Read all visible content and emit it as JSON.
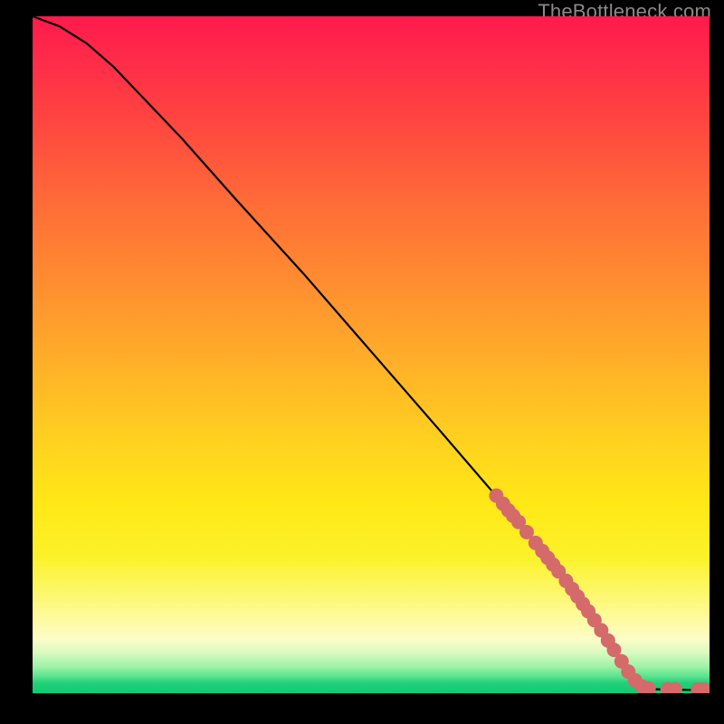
{
  "watermark": "TheBottleneck.com",
  "colors": {
    "point_fill": "#d46a6a",
    "curve_stroke": "#000000"
  },
  "chart_data": {
    "type": "line",
    "title": "",
    "xlabel": "",
    "ylabel": "",
    "xlim": [
      0,
      100
    ],
    "ylim": [
      0,
      100
    ],
    "grid": false,
    "note": "Axes are unlabeled in source; x/y normalized 0-100. Curve falls from top-left to a flat floor near y=0 past x≈88.",
    "curve": [
      {
        "x": 0,
        "y": 100
      },
      {
        "x": 4,
        "y": 98.5
      },
      {
        "x": 8,
        "y": 96
      },
      {
        "x": 12,
        "y": 92.5
      },
      {
        "x": 16,
        "y": 88.3
      },
      {
        "x": 22,
        "y": 82
      },
      {
        "x": 30,
        "y": 73
      },
      {
        "x": 40,
        "y": 62
      },
      {
        "x": 50,
        "y": 50.5
      },
      {
        "x": 60,
        "y": 39
      },
      {
        "x": 68,
        "y": 29.7
      },
      {
        "x": 72,
        "y": 25
      },
      {
        "x": 76,
        "y": 20.2
      },
      {
        "x": 80,
        "y": 15
      },
      {
        "x": 84,
        "y": 9.3
      },
      {
        "x": 86,
        "y": 6.3
      },
      {
        "x": 88,
        "y": 3.2
      },
      {
        "x": 89.5,
        "y": 1.2
      },
      {
        "x": 91,
        "y": 0.6
      },
      {
        "x": 94,
        "y": 0.55
      },
      {
        "x": 97,
        "y": 0.5
      },
      {
        "x": 100,
        "y": 0.5
      }
    ],
    "points": [
      {
        "x": 68.5,
        "y": 29.2
      },
      {
        "x": 69.5,
        "y": 28.0
      },
      {
        "x": 70.3,
        "y": 27.0
      },
      {
        "x": 71.0,
        "y": 26.2
      },
      {
        "x": 71.8,
        "y": 25.3
      },
      {
        "x": 73.0,
        "y": 23.8
      },
      {
        "x": 74.3,
        "y": 22.2
      },
      {
        "x": 75.3,
        "y": 21.0
      },
      {
        "x": 76.1,
        "y": 20.0
      },
      {
        "x": 76.9,
        "y": 19.0
      },
      {
        "x": 77.7,
        "y": 18.0
      },
      {
        "x": 78.8,
        "y": 16.6
      },
      {
        "x": 79.7,
        "y": 15.4
      },
      {
        "x": 80.5,
        "y": 14.3
      },
      {
        "x": 81.3,
        "y": 13.2
      },
      {
        "x": 82.1,
        "y": 12.1
      },
      {
        "x": 83.0,
        "y": 10.8
      },
      {
        "x": 84.0,
        "y": 9.3
      },
      {
        "x": 85.0,
        "y": 7.8
      },
      {
        "x": 85.9,
        "y": 6.4
      },
      {
        "x": 87.0,
        "y": 4.7
      },
      {
        "x": 88.0,
        "y": 3.2
      },
      {
        "x": 89.0,
        "y": 1.9
      },
      {
        "x": 90.0,
        "y": 1.0
      },
      {
        "x": 91.0,
        "y": 0.7
      },
      {
        "x": 93.8,
        "y": 0.6
      },
      {
        "x": 94.9,
        "y": 0.6
      },
      {
        "x": 98.3,
        "y": 0.55
      },
      {
        "x": 99.2,
        "y": 0.55
      }
    ],
    "point_radius_px": 8
  }
}
